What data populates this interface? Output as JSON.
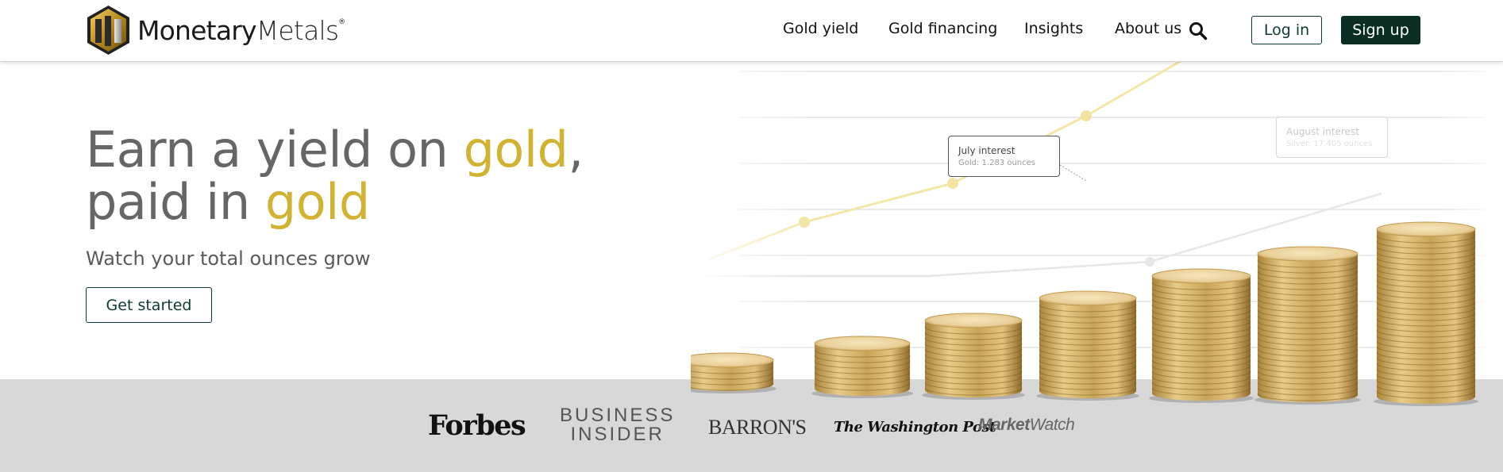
{
  "brand": {
    "name_bold": "Monetary",
    "name_light": "Metals",
    "reg": "®"
  },
  "nav": {
    "items": [
      "Gold yield",
      "Gold financing",
      "Insights",
      "About us"
    ],
    "login_label": "Log in",
    "signup_label": "Sign up"
  },
  "hero": {
    "line1_a": "Earn a yield on ",
    "line1_gold": "gold",
    "line1_b": ",",
    "line2_a": "paid in ",
    "line2_gold": "gold",
    "subline": "Watch your total ounces grow",
    "cta_label": "Get started"
  },
  "tooltips": {
    "july_title": "July interest",
    "july_detail": "Gold: 1.283 ounces",
    "august_title": "August interest",
    "august_detail": "Silver: 17.405 ounces"
  },
  "press": {
    "forbes": "Forbes",
    "business": "BUSINESS",
    "insider": "INSIDER",
    "barrons": "BARRON'S",
    "wapo": "The Washington Post",
    "mw_a": "Market",
    "mw_b": "Watch"
  },
  "colors": {
    "gold": "#d1b232",
    "dark_green": "#0b2e22",
    "press_bg": "#d8d8d8",
    "text_gray": "#666666"
  },
  "icons": {
    "search": "search-icon",
    "logo": "monetary-metals-logo-icon"
  }
}
